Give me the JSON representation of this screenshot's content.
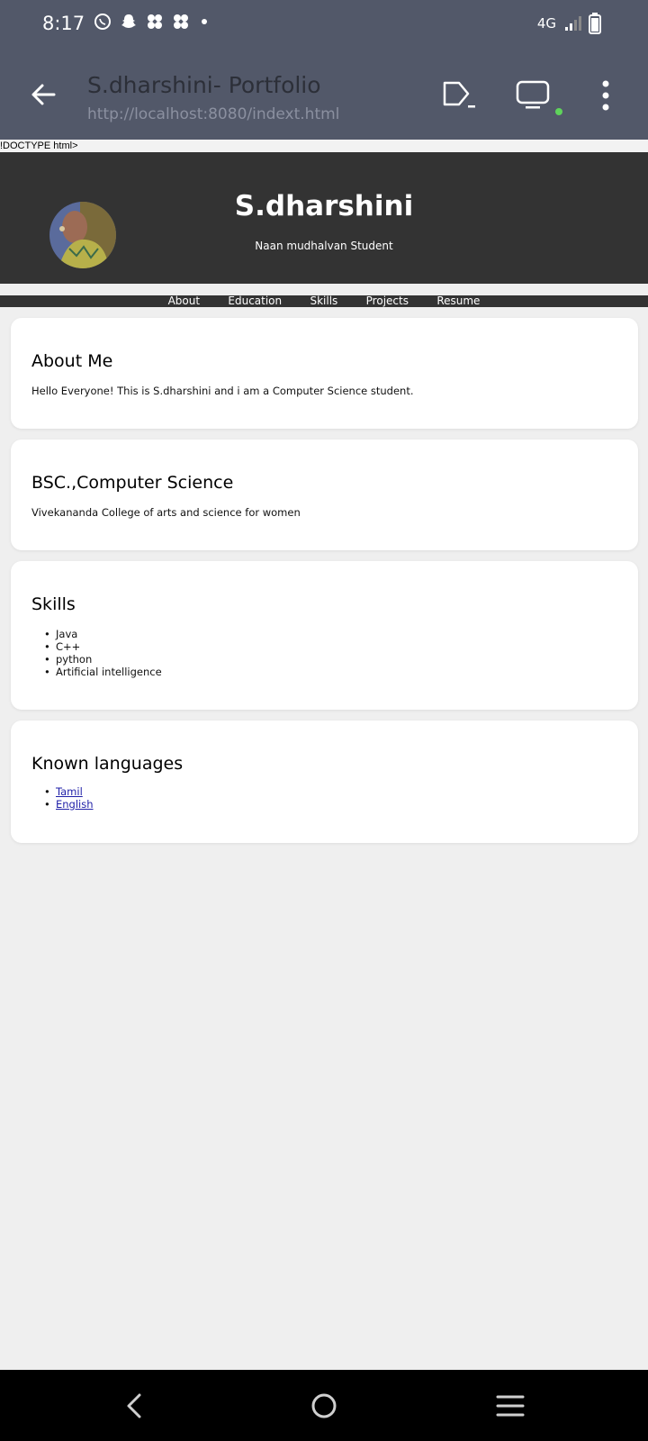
{
  "status_bar": {
    "time": "8:17",
    "network": "4G",
    "left_icons": [
      "whatsapp-icon",
      "snapchat-icon",
      "pinwheel-icon",
      "pinwheel-icon",
      "notification-dot-icon"
    ],
    "right_icons": [
      "signal-icon",
      "battery-icon"
    ]
  },
  "app_bar": {
    "title": "S.dharshini- Portfolio",
    "url": "http://localhost:8080/indext.html",
    "actions": [
      "open-in-browser-icon",
      "device-icon",
      "more-vert-icon"
    ],
    "device_status_color": "#5fd35b"
  },
  "page": {
    "doctype_text": "!DOCTYPE html>",
    "header": {
      "name": "S.dharshini",
      "tagline": "Naan mudhalvan Student"
    },
    "nav": [
      "About",
      "Education",
      "Skills",
      "Projects",
      "Resume"
    ],
    "about": {
      "heading": "About Me",
      "text": "Hello Everyone! This is S.dharshini and i am a Computer Science student."
    },
    "education": {
      "heading": "BSC.,Computer Science",
      "text": "Vivekananda College of arts and science for women"
    },
    "skills": {
      "heading": "Skills",
      "items": [
        "Java",
        "C++",
        "python",
        "Artificial intelligence"
      ]
    },
    "languages": {
      "heading": "Known languages",
      "items": [
        "Tamil",
        "English"
      ]
    }
  },
  "colors": {
    "chrome": "#525869",
    "header_bg": "#333333",
    "page_bg": "#efefef",
    "link": "#1f1fa8"
  },
  "system_nav": [
    "back-icon",
    "home-icon",
    "recents-icon"
  ]
}
